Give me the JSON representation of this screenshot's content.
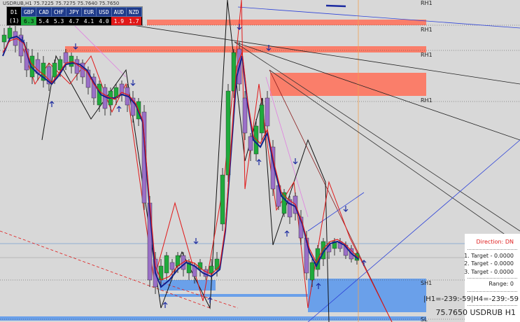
{
  "header": {
    "symbol_line": "USDRUB,H1  75.7225 75.7275 75.7640 75.7650"
  },
  "strength_table": {
    "timeframe": "D1",
    "row_label": "(1)",
    "currencies": [
      "GBP",
      "CAD",
      "CHF",
      "JPY",
      "EUR",
      "USD",
      "AUD",
      "NZD"
    ],
    "values": [
      {
        "v": "6.3",
        "style": "green"
      },
      {
        "v": "5.4",
        "style": "plain"
      },
      {
        "v": "5.3",
        "style": "plain"
      },
      {
        "v": "4.7",
        "style": "plain"
      },
      {
        "v": "4.1",
        "style": "plain"
      },
      {
        "v": "4.0",
        "style": "plain"
      },
      {
        "v": "1.9",
        "style": "red"
      },
      {
        "v": "1.7",
        "style": "red"
      }
    ]
  },
  "levels": {
    "rh1": "RH1",
    "sh1": "SH1",
    "sl": "SL"
  },
  "info_panel": {
    "direction": "Direction: DN",
    "target1": "1. Target - 0.0000",
    "target2": "2. Target - 0.0000",
    "target3": "3. Target - 0.0000",
    "range": "Range: 0",
    "hl": "|H1=-239:-59|H4=-239:-59",
    "price": "75.7650 USDRUB H1"
  },
  "colors": {
    "background": "#d8d8d8",
    "bull_candle": "#1faa3c",
    "bear_candle": "#9a6fc7",
    "resistance_zone": "#fa7e6a",
    "support_zone": "#6aa0ea",
    "ma_blue": "#12208c",
    "ma_red": "#e01818",
    "vertical_line": "#f0a050"
  }
}
